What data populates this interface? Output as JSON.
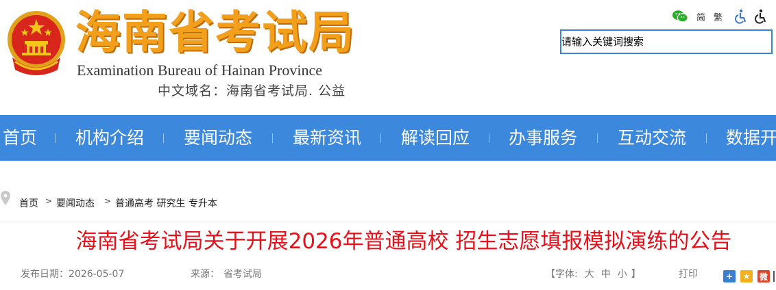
{
  "header": {
    "logo_cn": "海南省考试局",
    "logo_en": "Examination Bureau of Hainan Province",
    "domain_text": "中文域名：海南省考试局. 公益"
  },
  "tools": {
    "simplified": "简",
    "traditional": "繁"
  },
  "search": {
    "placeholder": "请输入关键词搜索"
  },
  "nav": {
    "items": [
      "首页",
      "机构介绍",
      "要闻动态",
      "最新资讯",
      "解读回应",
      "办事服务",
      "互动交流",
      "数据开"
    ]
  },
  "breadcrumb": {
    "items": [
      "首页",
      "要闻动态",
      "普通高考 研究生 专升本"
    ],
    "separator": ">"
  },
  "article": {
    "title": "海南省考试局关于开展2026年普通高校 招生志愿填报模拟演练的公告",
    "publish_label": "发布日期：",
    "publish_date": "2026-05-07",
    "source_label": "来源：",
    "source": "省考试局",
    "font_label_open": "【字体:",
    "font_large": "大",
    "font_medium": "中",
    "font_small": "小",
    "font_label_close": "】",
    "print": "打印"
  },
  "colors": {
    "nav_bg": "#3b88dc",
    "title_red": "#e8101a",
    "logo_orange": "#f2a01c"
  }
}
